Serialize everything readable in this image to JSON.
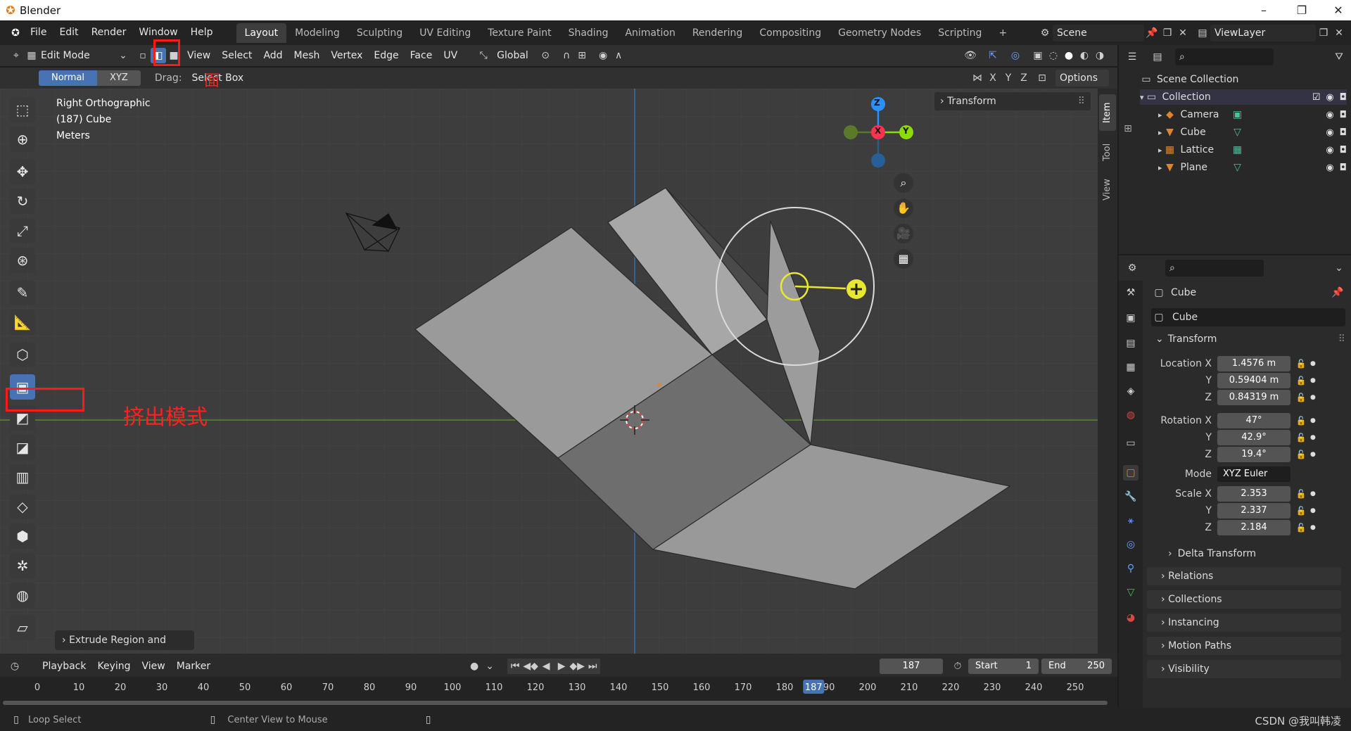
{
  "app": {
    "title": "Blender",
    "window_controls": [
      "minimize",
      "maximize",
      "close"
    ]
  },
  "topbar": {
    "menus": [
      "File",
      "Edit",
      "Render",
      "Window",
      "Help"
    ],
    "workspaces": [
      "Layout",
      "Modeling",
      "Sculpting",
      "UV Editing",
      "Texture Paint",
      "Shading",
      "Animation",
      "Rendering",
      "Compositing",
      "Geometry Nodes",
      "Scripting",
      "+"
    ],
    "active_workspace": "Layout",
    "scene": "Scene",
    "view_layer": "ViewLayer"
  },
  "header": {
    "mode": "Edit Mode",
    "menus": [
      "View",
      "Select",
      "Add",
      "Mesh",
      "Vertex",
      "Edge",
      "Face",
      "UV"
    ],
    "orientation": "Global",
    "options": "Options"
  },
  "toolhdr": {
    "normal": "Normal",
    "xyz": "XYZ",
    "drag_label": "Drag:",
    "drag_value": "Select Box",
    "axes": [
      "X",
      "Y",
      "Z"
    ]
  },
  "viewport": {
    "info": [
      "Right Orthographic",
      "(187) Cube",
      "Meters"
    ],
    "transform_panel": "Transform",
    "tabs": [
      "Item",
      "Tool",
      "View"
    ],
    "last_op": "Extrude Region and Move",
    "gizmo": {
      "z": "Z",
      "x": "X",
      "y": "Y"
    }
  },
  "annotations": {
    "face_glyph": "面",
    "extrude_mode": "挤出模式"
  },
  "outliner": {
    "scene_collection": "Scene Collection",
    "collection": "Collection",
    "items": [
      {
        "name": "Camera",
        "icon": "camera-icon",
        "color": "#e0832b"
      },
      {
        "name": "Cube",
        "icon": "mesh-icon",
        "color": "#e0832b"
      },
      {
        "name": "Lattice",
        "icon": "lattice-icon",
        "color": "#e0832b"
      },
      {
        "name": "Plane",
        "icon": "mesh-icon",
        "color": "#e0832b"
      }
    ]
  },
  "properties": {
    "object_name": "Cube",
    "data_name": "Cube",
    "transform": "Transform",
    "location_label": "Location X",
    "location": [
      "1.4576 m",
      "0.59404 m",
      "0.84319 m"
    ],
    "rotation_label": "Rotation X",
    "rotation": [
      "47°",
      "42.9°",
      "19.4°"
    ],
    "mode_label": "Mode",
    "mode": "XYZ Euler",
    "scale_label": "Scale X",
    "scale": [
      "2.353",
      "2.337",
      "2.184"
    ],
    "y": "Y",
    "z": "Z",
    "sections": [
      "Delta Transform",
      "Relations",
      "Collections",
      "Instancing",
      "Motion Paths",
      "Visibility"
    ]
  },
  "timeline": {
    "menus": [
      "Playback",
      "Keying",
      "View",
      "Marker"
    ],
    "current_frame": "187",
    "start_label": "Start",
    "start": "1",
    "end_label": "End",
    "end": "250",
    "ticks": [
      "0",
      "10",
      "20",
      "30",
      "40",
      "50",
      "60",
      "70",
      "80",
      "90",
      "100",
      "110",
      "120",
      "130",
      "140",
      "150",
      "160",
      "170",
      "180",
      "190",
      "200",
      "210",
      "220",
      "230",
      "240",
      "250"
    ],
    "playhead": "187"
  },
  "statusbar": {
    "left": "Loop Select",
    "middle": "Center View to Mouse",
    "watermark": "CSDN @我叫韩凌"
  },
  "colors": {
    "accent": "#4772b3",
    "x_axis": "#ff3352",
    "y_axis": "#8bdc00",
    "z_axis": "#2890ff",
    "annotation": "#ff1a1a"
  }
}
